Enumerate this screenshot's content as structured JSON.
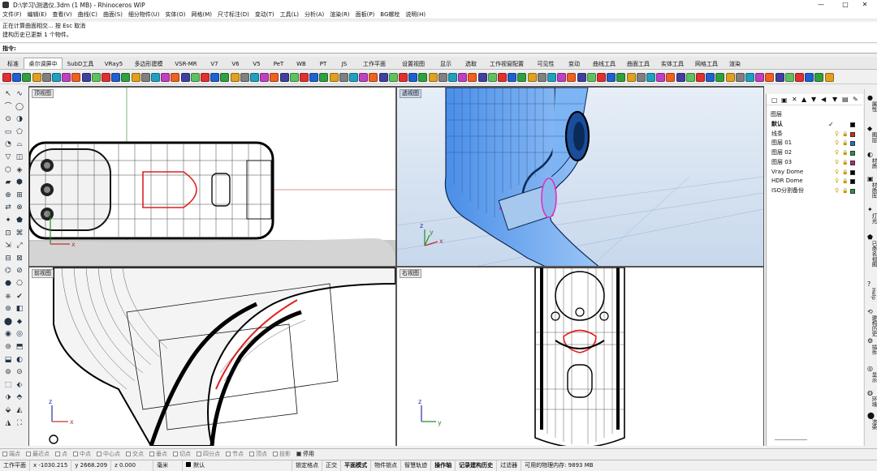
{
  "window": {
    "title": "D:\\学习\\测温仪.3dm (1 MB) - Rhinoceros WIP",
    "minimize": "—",
    "maximize": "□",
    "close": "✕"
  },
  "menu": [
    "文件(F)",
    "编辑(E)",
    "查看(V)",
    "曲线(C)",
    "曲面(S)",
    "细分物件(U)",
    "实体(O)",
    "网格(M)",
    "尺寸标注(D)",
    "变动(T)",
    "工具(L)",
    "分析(A)",
    "渲染(R)",
    "面板(P)",
    "BG螺栓",
    "说明(H)"
  ],
  "command_history": [
    "正在计算曲面相交... 按 Esc 取消",
    "建构历史已更新 1 个物件。"
  ],
  "command_prompt": "指令:",
  "tabs": [
    "标准",
    "桌尔调屏中",
    "SubD工具",
    "VRay5",
    "多边形建模",
    "VSR-MR",
    "V7",
    "V6",
    "V5",
    "PeT",
    "WB",
    "PT",
    "JS",
    "工作平面",
    "设置视图",
    "显示",
    "选取",
    "工作视窗配置",
    "可见性",
    "变动",
    "曲线工具",
    "曲面工具",
    "实体工具",
    "网格工具",
    "渲染"
  ],
  "viewports": {
    "top": {
      "label": "顶视图",
      "x_axis": "x",
      "y_axis": "y"
    },
    "perspective": {
      "label": "透视图",
      "x_axis": "x",
      "y_axis": "y",
      "z_axis": "z"
    },
    "front": {
      "label": "前视图",
      "x_axis": "x",
      "z_axis": "z"
    },
    "right": {
      "label": "右视图",
      "y_axis": "y",
      "z_axis": "z"
    }
  },
  "layers_panel": {
    "title": "图层",
    "layers": [
      {
        "name": "默认",
        "color": "#000000",
        "current": true
      },
      {
        "name": "线条",
        "color": "#e02020"
      },
      {
        "name": "图层 01",
        "color": "#1e6fd9"
      },
      {
        "name": "图层 02",
        "color": "#1aa030"
      },
      {
        "name": "图层 03",
        "color": "#c0207a"
      },
      {
        "name": "Vray Dome",
        "color": "#000000"
      },
      {
        "name": "HDR Dome",
        "color": "#000000"
      },
      {
        "name": "ISO分割备份",
        "color": "#1aa030"
      }
    ]
  },
  "side_tabs": [
    "属性",
    "图层",
    "材质",
    "材质库",
    "灯光",
    "已命名视图",
    "Help",
    "建构历史",
    "插件",
    "显示",
    "环境",
    "渲染"
  ],
  "osnaps": [
    {
      "label": "端点",
      "on": false
    },
    {
      "label": "最近点",
      "on": false
    },
    {
      "label": "点",
      "on": false
    },
    {
      "label": "中点",
      "on": false
    },
    {
      "label": "中心点",
      "on": false
    },
    {
      "label": "交点",
      "on": false
    },
    {
      "label": "垂点",
      "on": false
    },
    {
      "label": "切点",
      "on": false
    },
    {
      "label": "四分点",
      "on": false
    },
    {
      "label": "节点",
      "on": false
    },
    {
      "label": "顶点",
      "on": false
    },
    {
      "label": "投影",
      "on": false
    },
    {
      "label": "停用",
      "on": true
    }
  ],
  "status": {
    "cplane": "工作平面",
    "x": "x -1030.215",
    "y": "y 2668.209",
    "z": "z 0.000",
    "units": "毫米",
    "layer": "默认",
    "toggles": [
      "锁定格点",
      "正交",
      "平面模式",
      "物件锁点",
      "智慧轨迹",
      "操作轴",
      "记录建构历史",
      "过滤器"
    ],
    "memory": "可用的物理内存: 9893 MB"
  }
}
